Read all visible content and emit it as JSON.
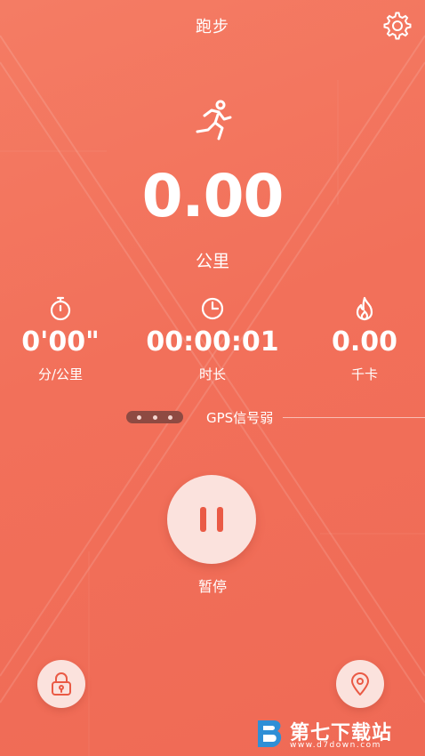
{
  "header": {
    "title": "跑步"
  },
  "main": {
    "distance": "0.00",
    "distance_unit": "公里"
  },
  "stats": [
    {
      "value": "0'00\"",
      "label": "分/公里",
      "icon": "stopwatch-icon"
    },
    {
      "value": "00:00:01",
      "label": "时长",
      "icon": "clock-icon"
    },
    {
      "value": "0.00",
      "label": "千卡",
      "icon": "flame-icon"
    }
  ],
  "gps": {
    "status": "GPS信号弱"
  },
  "controls": {
    "pause_label": "暂停"
  },
  "watermark": {
    "text": "第七下载站",
    "url": "www.d7down.com"
  },
  "colors": {
    "background": "#f2705a",
    "button_fill": "#fbe2dd",
    "accent": "#ea5a45"
  }
}
